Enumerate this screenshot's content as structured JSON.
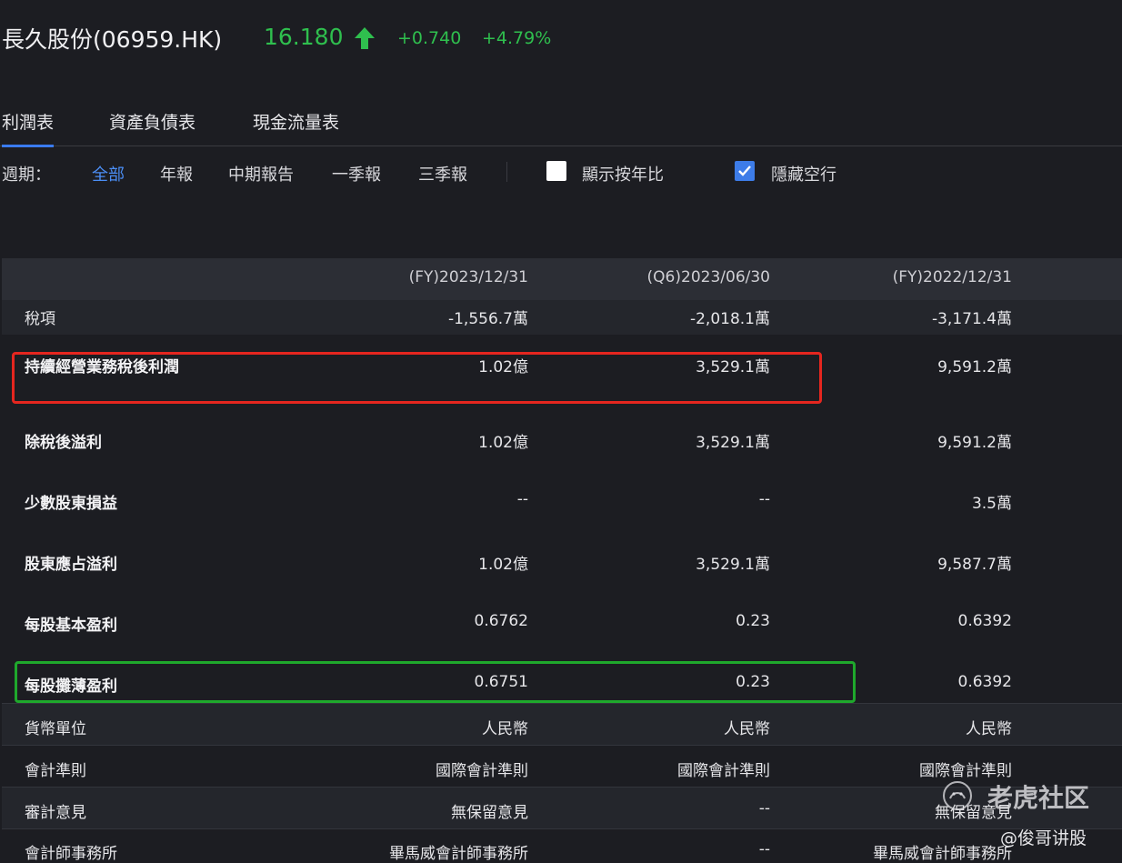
{
  "header": {
    "stock_name": "長久股份(06959.HK)",
    "price": "16.180",
    "change": "+0.740",
    "change_pct": "+4.79%",
    "trend_icon": "up-arrow-icon",
    "up_color": "#2fbf4e"
  },
  "tabs": [
    {
      "label": "利潤表",
      "active": true
    },
    {
      "label": "資產負債表",
      "active": false
    },
    {
      "label": "現金流量表",
      "active": false
    }
  ],
  "filter": {
    "label": "週期：",
    "options": [
      {
        "label": "全部",
        "active": true
      },
      {
        "label": "年報",
        "active": false
      },
      {
        "label": "中期報告",
        "active": false
      },
      {
        "label": "一季報",
        "active": false
      },
      {
        "label": "三季報",
        "active": false
      }
    ],
    "show_yoy": {
      "label": "顯示按年比",
      "checked": false
    },
    "hide_empty": {
      "label": "隱藏空行",
      "checked": true
    }
  },
  "table": {
    "columns": [
      "(FY)2023/12/31",
      "(Q6)2023/06/30",
      "(FY)2022/12/31"
    ],
    "rows": [
      {
        "label": "稅項",
        "values": [
          "-1,556.7萬",
          "-2,018.1萬",
          "-3,171.4萬"
        ]
      },
      {
        "label": "持續經營業務稅後利潤",
        "values": [
          "1.02億",
          "3,529.1萬",
          "9,591.2萬"
        ]
      },
      {
        "label": "除稅後溢利",
        "values": [
          "1.02億",
          "3,529.1萬",
          "9,591.2萬"
        ]
      },
      {
        "label": "少數股東損益",
        "values": [
          "--",
          "--",
          "3.5萬"
        ]
      },
      {
        "label": "股東應占溢利",
        "values": [
          "1.02億",
          "3,529.1萬",
          "9,587.7萬"
        ]
      },
      {
        "label": "每股基本盈利",
        "values": [
          "0.6762",
          "0.23",
          "0.6392"
        ]
      },
      {
        "label": "每股攤薄盈利",
        "values": [
          "0.6751",
          "0.23",
          "0.6392"
        ]
      },
      {
        "label": "貨幣單位",
        "values": [
          "人民幣",
          "人民幣",
          "人民幣"
        ]
      },
      {
        "label": "會計準則",
        "values": [
          "國際會計準則",
          "國際會計準則",
          "國際會計準則"
        ]
      },
      {
        "label": "審計意見",
        "values": [
          "無保留意見",
          "--",
          "無保留意見"
        ]
      },
      {
        "label": "會計師事務所",
        "values": [
          "畢馬威會計師事務所",
          "--",
          "畢馬威會計師事務所"
        ]
      }
    ]
  },
  "annotations": {
    "red_box_color": "#e5261f",
    "green_box_color": "#1fa82c"
  },
  "watermark": {
    "text": "老虎社区",
    "handle": "@俊哥讲股"
  }
}
